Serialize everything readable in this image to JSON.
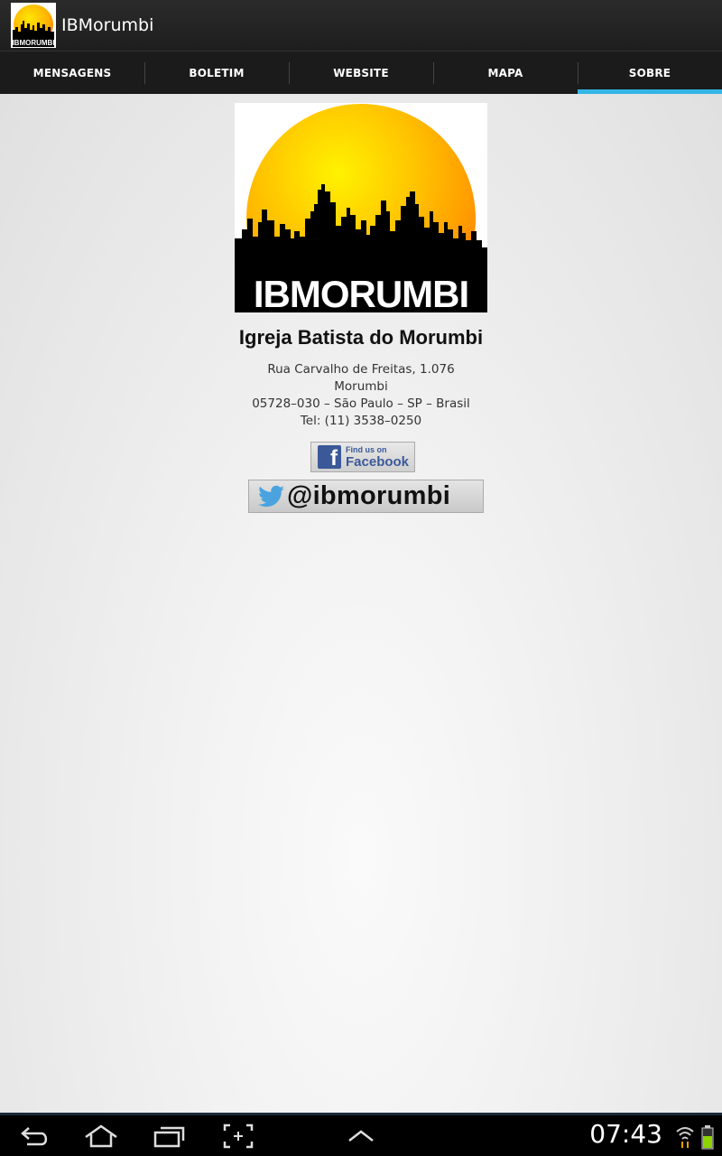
{
  "app": {
    "title": "IBMorumbi"
  },
  "tabs": [
    {
      "label": "MENSAGENS",
      "active": false
    },
    {
      "label": "BOLETIM",
      "active": false
    },
    {
      "label": "WEBSITE",
      "active": false
    },
    {
      "label": "MAPA",
      "active": false
    },
    {
      "label": "SOBRE",
      "active": true
    }
  ],
  "about": {
    "logo_text": "IBMORUMBI",
    "name": "Igreja Batista do Morumbi",
    "address": [
      "Rua Carvalho de Freitas, 1.076",
      "Morumbi",
      "05728–030 – São Paulo – SP – Brasil",
      "Tel: (11) 3538–0250"
    ],
    "facebook": {
      "small": "Find us on",
      "big": "Facebook"
    },
    "twitter": {
      "handle": "@ibmorumbi"
    }
  },
  "status": {
    "time": "07:43"
  },
  "colors": {
    "accent": "#33b5e5",
    "facebook": "#3b5998",
    "twitter": "#4aa3df"
  }
}
